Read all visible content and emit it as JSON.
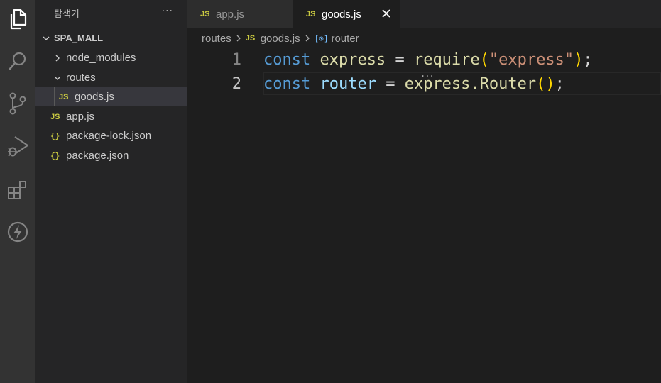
{
  "activity_bar": {
    "icons": [
      "files-icon",
      "search-icon",
      "source-control-icon",
      "run-debug-icon",
      "extensions-icon",
      "thunder-client-icon"
    ]
  },
  "explorer": {
    "title": "탐색기",
    "more_label": "···",
    "root_folder": "SPA_MALL",
    "items": [
      {
        "label": "node_modules",
        "type": "folder",
        "expanded": false
      },
      {
        "label": "routes",
        "type": "folder",
        "expanded": true
      },
      {
        "label": "goods.js",
        "type": "js",
        "badge": "JS",
        "selected": true
      },
      {
        "label": "app.js",
        "type": "js",
        "badge": "JS"
      },
      {
        "label": "package-lock.json",
        "type": "json",
        "badge": "{}"
      },
      {
        "label": "package.json",
        "type": "json",
        "badge": "{}"
      }
    ]
  },
  "tabs": [
    {
      "label": "app.js",
      "badge": "JS",
      "active": false
    },
    {
      "label": "goods.js",
      "badge": "JS",
      "active": true,
      "close_label": "×"
    }
  ],
  "breadcrumb": {
    "folder": "routes",
    "file_badge": "JS",
    "file": "goods.js",
    "symbol_icon": "[⊙]",
    "symbol": "router"
  },
  "editor": {
    "lines": [
      {
        "number": "1",
        "tokens": [
          "const",
          " express ",
          "=",
          " require",
          "(",
          "\"express\"",
          ")",
          ";"
        ]
      },
      {
        "number": "2",
        "tokens": [
          "const",
          " router ",
          "=",
          " express.Router",
          "(",
          ")",
          ";"
        ]
      }
    ],
    "hint_dots": "...",
    "current_line": 2
  },
  "colors": {
    "keyword": "#569cd6",
    "variable": "#9cdcfe",
    "function": "#dcdcaa",
    "string": "#ce9178",
    "bracket": "#ffd700",
    "js_badge": "#cbcb41"
  }
}
